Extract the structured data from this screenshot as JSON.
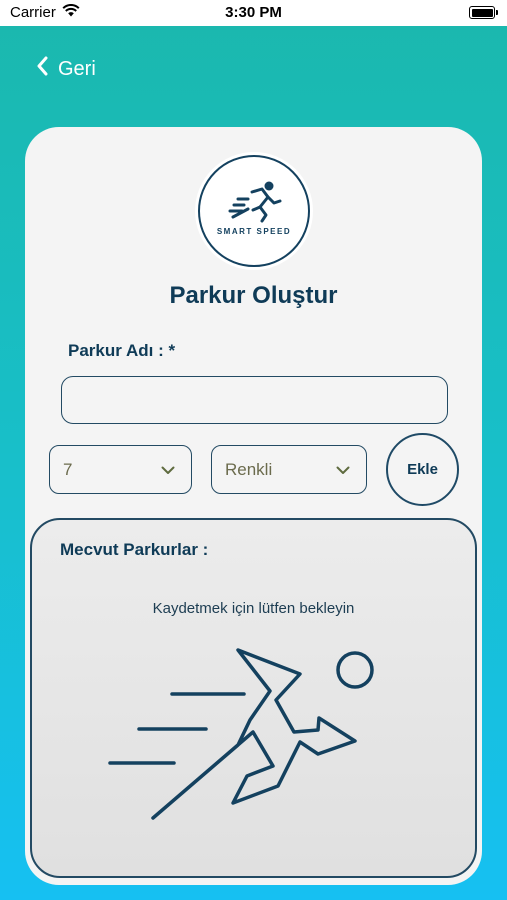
{
  "status_bar": {
    "carrier": "Carrier",
    "time": "3:30 PM"
  },
  "nav": {
    "back_label": "Geri"
  },
  "logo": {
    "text": "SMART SPEED"
  },
  "page": {
    "title": "Parkur Oluştur"
  },
  "form": {
    "name_label": "Parkur Adı : *",
    "name_value": "",
    "count_select": "7",
    "color_select": "Renkli",
    "add_label": "Ekle"
  },
  "existing": {
    "title": "Mecvut Parkurlar :",
    "message": "Kaydetmek için lütfen bekleyin"
  },
  "colors": {
    "brand_dark": "#0f3b57",
    "gradient_top": "#1bb8ad",
    "gradient_bottom": "#16c0f2"
  }
}
